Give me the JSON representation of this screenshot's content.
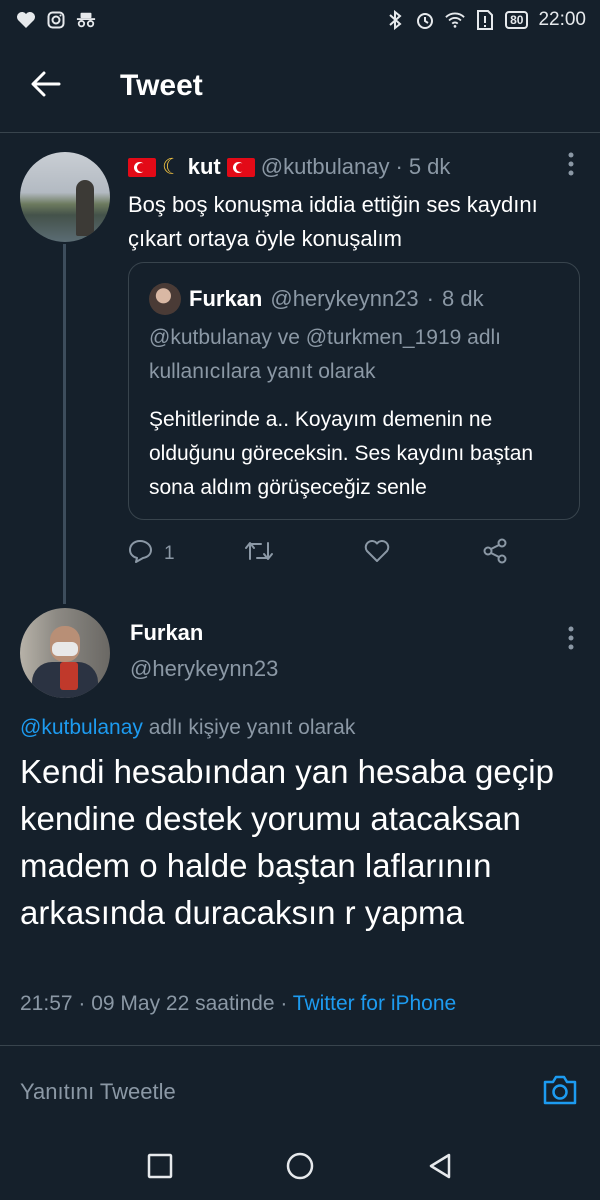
{
  "statusbar": {
    "left_icons": [
      "heart-icon",
      "instagram-icon",
      "incognito-icon"
    ],
    "right_icons": [
      "bluetooth-icon",
      "alarm-icon",
      "wifi-icon",
      "sim-alert-icon"
    ],
    "battery": "80",
    "time": "22:00"
  },
  "header": {
    "back_icon": "arrow-left-icon",
    "title": "Tweet"
  },
  "tweet1": {
    "display_name": "kut",
    "handle": "@kutbulanay",
    "separator": "·",
    "time": "5 dk",
    "text": "Boş boş konuşma iddia ettiğin ses kaydını çıkart ortaya öyle konuşalım",
    "quote": {
      "display_name": "Furkan",
      "handle": "@herykeynn23",
      "separator": "·",
      "time": "8 dk",
      "reply_context": "@kutbulanay ve @turkmen_1919 adlı kullanıcılara yanıt olarak",
      "text": "Şehitlerinde a.. Koyayım demenin ne olduğunu göreceksin. Ses kaydını baştan sona aldım görüşeceğiz senle"
    },
    "actions": {
      "reply_count": "1",
      "retweet_count": "",
      "like_count": ""
    }
  },
  "tweet2": {
    "display_name": "Furkan",
    "handle": "@herykeynn23",
    "reply_mention": "@kutbulanay",
    "reply_suffix": " adlı kişiye yanıt olarak",
    "text": "Kendi hesabından yan hesaba geçip kendine destek yorumu atacaksan madem o halde baştan laflarının arkasında duracaksın r yapma",
    "meta_time": "21:57 · 09 May 22 saatinde · ",
    "meta_source": "Twitter for iPhone"
  },
  "composer": {
    "placeholder": "Yanıtını Tweetle"
  },
  "colors": {
    "background": "#15202b",
    "accent": "#1d9bf0",
    "muted": "#8b98a5",
    "border": "#38444d"
  }
}
